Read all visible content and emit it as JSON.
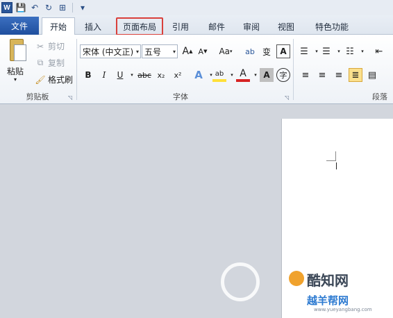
{
  "quick_access": {
    "app_icon": "W",
    "save_icon": "save-icon",
    "undo_icon": "undo-icon",
    "redo_icon": "redo-icon",
    "customize_icon": "customize-icon"
  },
  "tabs": [
    {
      "id": "file",
      "label": "文件"
    },
    {
      "id": "home",
      "label": "开始"
    },
    {
      "id": "insert",
      "label": "插入"
    },
    {
      "id": "layout",
      "label": "页面布局"
    },
    {
      "id": "ref",
      "label": "引用"
    },
    {
      "id": "mail",
      "label": "邮件"
    },
    {
      "id": "review",
      "label": "审阅"
    },
    {
      "id": "view",
      "label": "视图"
    },
    {
      "id": "special",
      "label": "特色功能"
    }
  ],
  "clipboard": {
    "paste_label": "粘贴",
    "cut_label": "剪切",
    "copy_label": "复制",
    "format_painter_label": "格式刷",
    "group_label": "剪贴板"
  },
  "font": {
    "font_name": "宋体 (中文正)",
    "font_size": "五号",
    "grow_label": "A",
    "shrink_label": "A",
    "case_label": "Aa",
    "bold": "B",
    "italic": "I",
    "underline": "U",
    "strike": "abc",
    "subscript": "x₂",
    "superscript": "x²",
    "group_label": "字体"
  },
  "paragraph": {
    "group_label": "段落"
  },
  "watermark": {
    "brand": "酷知网",
    "sub": "越羊帮网",
    "url": "www.yueyangbang.com"
  },
  "colors": {
    "accent_red": "#d9403b",
    "file_tab_blue": "#2a5699",
    "highlight_yellow": "#fbe08d"
  }
}
